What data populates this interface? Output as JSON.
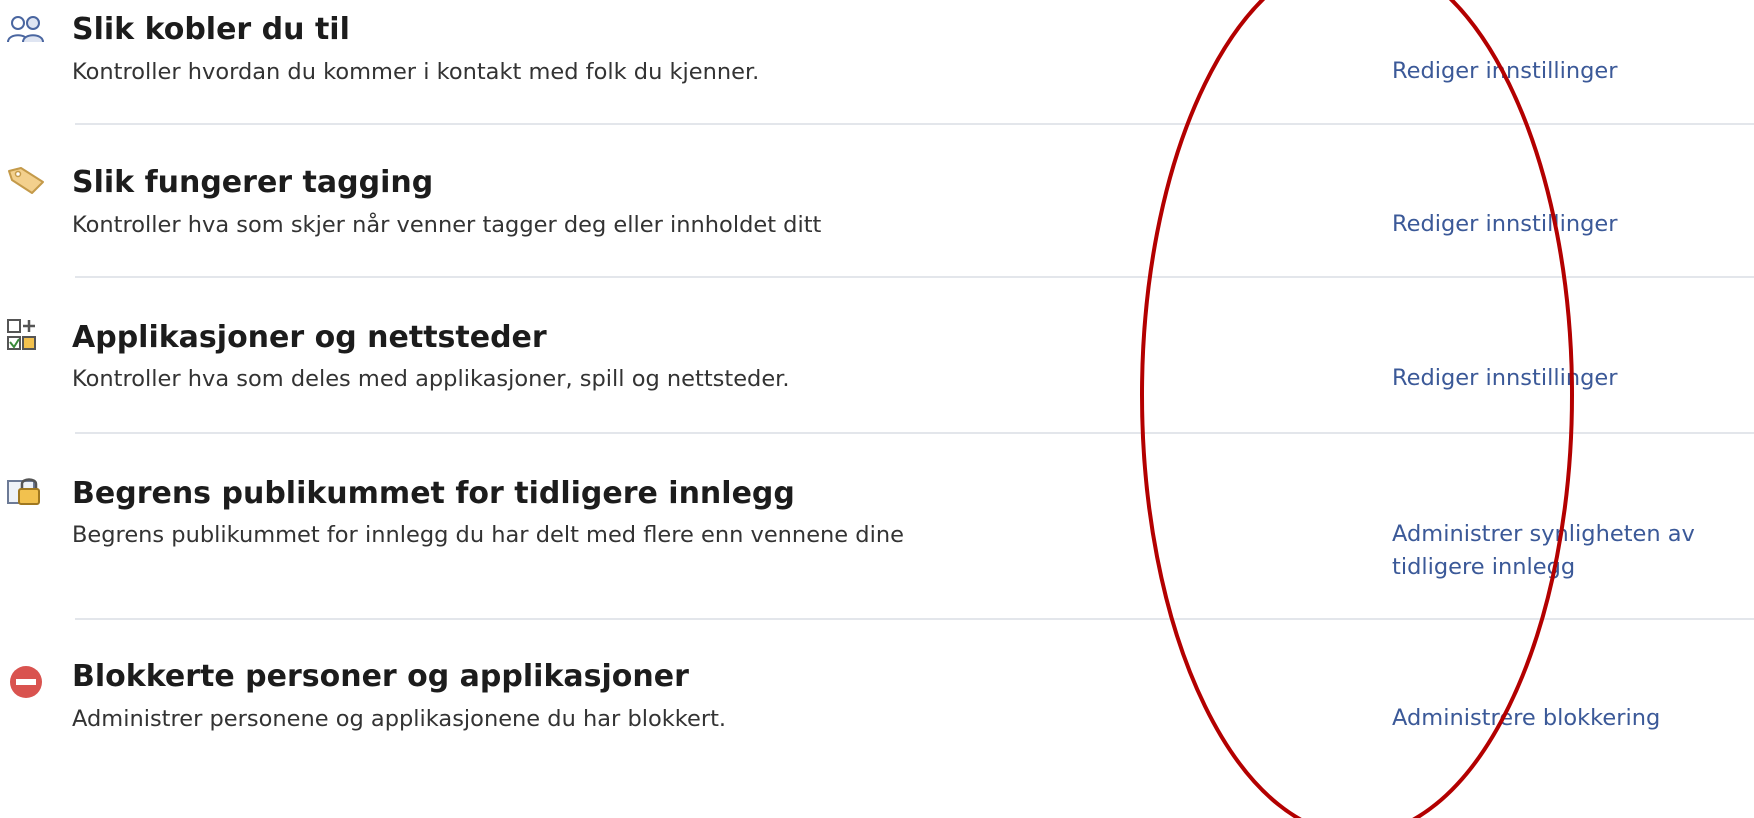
{
  "sections": [
    {
      "title": "Slik kobler du til",
      "description": "Kontroller hvordan du kommer i kontakt med folk du kjenner.",
      "action": "Rediger innstillinger",
      "icon": "people-icon"
    },
    {
      "title": "Slik fungerer tagging",
      "description": "Kontroller hva som skjer når venner tagger deg eller innholdet ditt",
      "action": "Rediger innstillinger",
      "icon": "tag-icon"
    },
    {
      "title": "Applikasjoner og nettsteder",
      "description": "Kontroller hva som deles med applikasjoner, spill og nettsteder.",
      "action": "Rediger innstillinger",
      "icon": "apps-icon"
    },
    {
      "title": "Begrens publikummet for tidligere innlegg",
      "description": "Begrens publikummet for innlegg du har delt med flere enn vennene dine",
      "action_line1": "Administrer synligheten av",
      "action_line2": "tidligere innlegg",
      "icon": "lock-icon"
    },
    {
      "title": "Blokkerte personer og applikasjoner",
      "description": "Administrer personene og applikasjonene du har blokkert.",
      "action": "Administrere blokkering",
      "icon": "blocked-icon"
    }
  ],
  "colors": {
    "link": "#3b5998",
    "title": "#1c1c1c",
    "text": "#333333",
    "divider": "#e3e6eb",
    "annotation": "#b30000",
    "blocked": "#d9534f"
  }
}
